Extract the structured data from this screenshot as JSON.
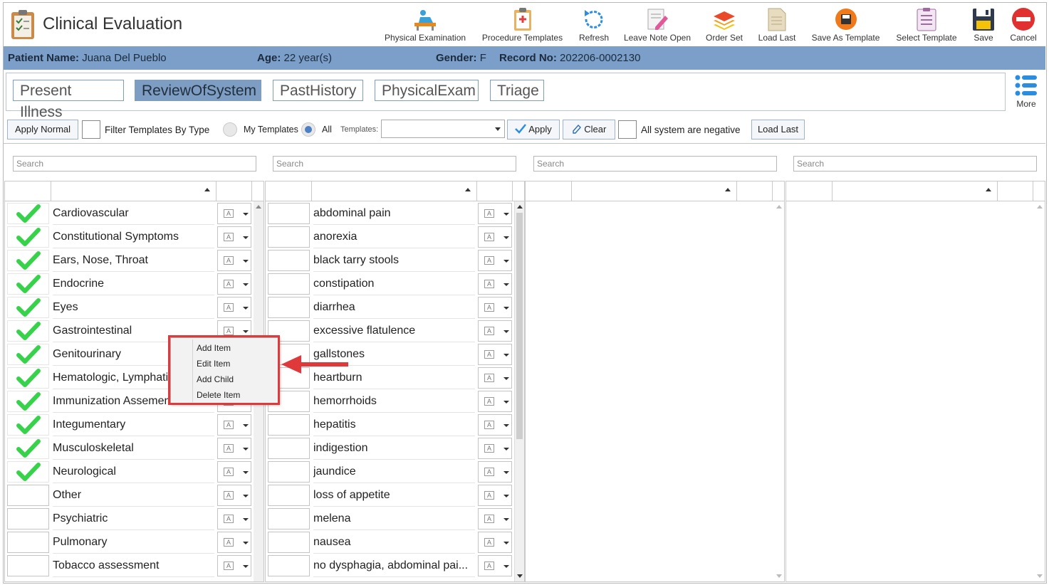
{
  "app": {
    "title": "Clinical Evaluation"
  },
  "toolbar": [
    {
      "label": "Physical Examination",
      "icon": "physical-exam-icon"
    },
    {
      "label": "Procedure Templates",
      "icon": "clipboard-icon"
    },
    {
      "label": "Refresh",
      "icon": "refresh-icon"
    },
    {
      "label": "Leave Note Open",
      "icon": "note-pencil-icon"
    },
    {
      "label": "Order Set",
      "icon": "layers-icon"
    },
    {
      "label": "Load Last",
      "icon": "document-icon"
    },
    {
      "label": "Save As Template",
      "icon": "save-as-icon"
    },
    {
      "label": "Select Template",
      "icon": "template-list-icon"
    },
    {
      "label": "Save",
      "icon": "floppy-icon"
    },
    {
      "label": "Cancel",
      "icon": "cancel-icon"
    }
  ],
  "patient": {
    "name_label": "Patient Name:",
    "name": "Juana Del Pueblo",
    "age_label": "Age:",
    "age": "22 year(s)",
    "gender_label": "Gender:",
    "gender": "F",
    "record_label": "Record No:",
    "record": "202206-0002130"
  },
  "tabs": [
    "Present Illness",
    "ReviewOfSystem",
    "PastHistory",
    "PhysicalExam",
    "Triage"
  ],
  "more_label": "More",
  "controls": {
    "apply_normal": "Apply Normal",
    "filter_by_type": "Filter Templates By Type",
    "my_templates": "My Templates",
    "all": "All",
    "templates_label": "Templates:",
    "apply": "Apply",
    "clear": "Clear",
    "all_negative": "All system are negative",
    "load_last": "Load Last"
  },
  "search_placeholder": "Search",
  "systems": [
    {
      "label": "Cardiovascular",
      "checked": true
    },
    {
      "label": "Constitutional Symptoms",
      "checked": true
    },
    {
      "label": "Ears, Nose, Throat",
      "checked": true
    },
    {
      "label": "Endocrine",
      "checked": true
    },
    {
      "label": "Eyes",
      "checked": true
    },
    {
      "label": "Gastrointestinal",
      "checked": true
    },
    {
      "label": "Genitourinary",
      "checked": true
    },
    {
      "label": "Hematologic, Lymphati",
      "checked": true
    },
    {
      "label": "Immunization Assemen",
      "checked": true
    },
    {
      "label": "Integumentary",
      "checked": true
    },
    {
      "label": "Musculoskeletal",
      "checked": true
    },
    {
      "label": "Neurological",
      "checked": true
    },
    {
      "label": "Other",
      "checked": false
    },
    {
      "label": "Psychiatric",
      "checked": false
    },
    {
      "label": "Pulmonary",
      "checked": false
    },
    {
      "label": "Tobacco assessment",
      "checked": false
    }
  ],
  "symptoms": [
    "abdominal pain",
    "anorexia",
    "black tarry stools",
    "constipation",
    "diarrhea",
    "excessive flatulence",
    "gallstones",
    "heartburn",
    "hemorrhoids",
    "hepatitis",
    "indigestion",
    "jaundice",
    "loss of appetite",
    "melena",
    "nausea",
    "no dysphagia, abdominal pai..."
  ],
  "context_menu": [
    "Add Item",
    "Edit Item",
    "Add Child",
    "Delete Item"
  ],
  "colors": {
    "accent": "#7b9fc9",
    "check": "#2ecc40",
    "highlight": "#e0393b"
  }
}
